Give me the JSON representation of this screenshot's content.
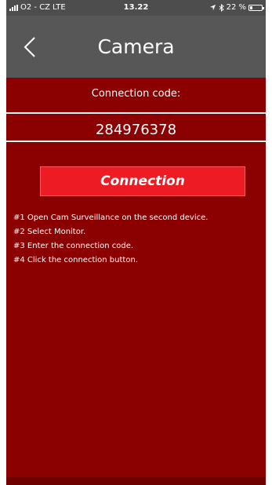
{
  "status_bar": {
    "carrier": "O2 - CZ",
    "network": "LTE",
    "time": "13.22",
    "battery_text": "22 %",
    "battery_level": 0.22
  },
  "nav": {
    "title": "Camera",
    "back_icon": "chevron-left-icon"
  },
  "connection": {
    "label": "Connection code:",
    "code": "284976378",
    "button_label": "Connection"
  },
  "instructions": [
    "#1 Open Cam Surveillance on the second device.",
    "#2 Select Monitor.",
    "#3 Enter the connection code.",
    "#4 Click the connection button."
  ],
  "colors": {
    "background": "#8b0000",
    "navbar": "#575757",
    "button": "#ed1c24"
  }
}
